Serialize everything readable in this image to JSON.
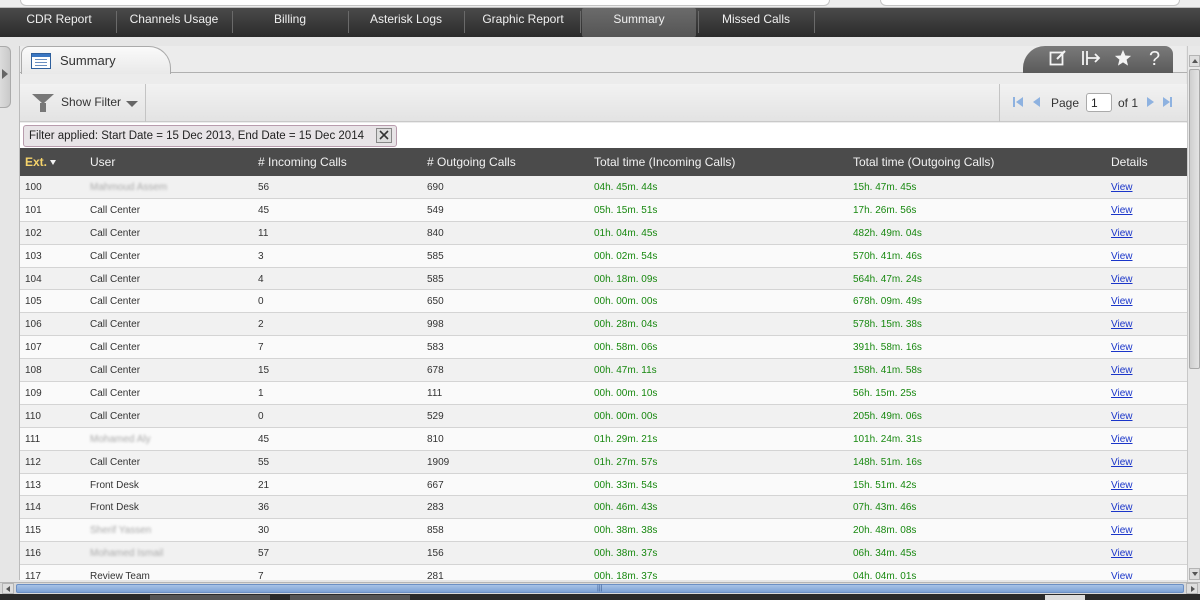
{
  "nav": {
    "items": [
      {
        "label": "CDR Report"
      },
      {
        "label": "Channels Usage"
      },
      {
        "label": "Billing"
      },
      {
        "label": "Asterisk Logs"
      },
      {
        "label": "Graphic Report"
      },
      {
        "label": "Summary"
      },
      {
        "label": "Missed Calls"
      }
    ],
    "active": "Summary"
  },
  "tab": {
    "label": "Summary"
  },
  "toolbar_icons": [
    "edit-icon",
    "export-icon",
    "star-icon",
    "help-icon"
  ],
  "toolbar_glyphs": {
    "help": "?"
  },
  "filter": {
    "show_filter_label": "Show Filter",
    "applied_text": "Filter applied: Start Date = 15 Dec 2013, End Date = 15 Dec 2014"
  },
  "pager": {
    "page_label": "Page",
    "page_value": "1",
    "of_label": "of 1"
  },
  "table": {
    "columns": [
      "Ext.",
      "User",
      "# Incoming Calls",
      "# Outgoing Calls",
      "Total time (Incoming Calls)",
      "Total time (Outgoing Calls)",
      "Details"
    ],
    "sorted_column": "Ext.",
    "rows": [
      {
        "ext": "100",
        "user": "Mahmoud Assem",
        "in": "56",
        "out": "690",
        "tin": "04h. 45m. 44s",
        "tout": "15h. 47m. 45s",
        "details": "View",
        "blur": true
      },
      {
        "ext": "101",
        "user": "Call Center",
        "in": "45",
        "out": "549",
        "tin": "05h. 15m. 51s",
        "tout": "17h. 26m. 56s",
        "details": "View",
        "blur": false
      },
      {
        "ext": "102",
        "user": "Call Center",
        "in": "11",
        "out": "840",
        "tin": "01h. 04m. 45s",
        "tout": "482h. 49m. 04s",
        "details": "View",
        "blur": false
      },
      {
        "ext": "103",
        "user": "Call Center",
        "in": "3",
        "out": "585",
        "tin": "00h. 02m. 54s",
        "tout": "570h. 41m. 46s",
        "details": "View",
        "blur": false
      },
      {
        "ext": "104",
        "user": "Call Center",
        "in": "4",
        "out": "585",
        "tin": "00h. 18m. 09s",
        "tout": "564h. 47m. 24s",
        "details": "View",
        "blur": false
      },
      {
        "ext": "105",
        "user": "Call Center",
        "in": "0",
        "out": "650",
        "tin": "00h. 00m. 00s",
        "tout": "678h. 09m. 49s",
        "details": "View",
        "blur": false
      },
      {
        "ext": "106",
        "user": "Call Center",
        "in": "2",
        "out": "998",
        "tin": "00h. 28m. 04s",
        "tout": "578h. 15m. 38s",
        "details": "View",
        "blur": false
      },
      {
        "ext": "107",
        "user": "Call Center",
        "in": "7",
        "out": "583",
        "tin": "00h. 58m. 06s",
        "tout": "391h. 58m. 16s",
        "details": "View",
        "blur": false
      },
      {
        "ext": "108",
        "user": "Call Center",
        "in": "15",
        "out": "678",
        "tin": "00h. 47m. 11s",
        "tout": "158h. 41m. 58s",
        "details": "View",
        "blur": false
      },
      {
        "ext": "109",
        "user": "Call Center",
        "in": "1",
        "out": "111",
        "tin": "00h. 00m. 10s",
        "tout": "56h. 15m. 25s",
        "details": "View",
        "blur": false
      },
      {
        "ext": "110",
        "user": "Call Center",
        "in": "0",
        "out": "529",
        "tin": "00h. 00m. 00s",
        "tout": "205h. 49m. 06s",
        "details": "View",
        "blur": false
      },
      {
        "ext": "111",
        "user": "Mohamed Aly",
        "in": "45",
        "out": "810",
        "tin": "01h. 29m. 21s",
        "tout": "101h. 24m. 31s",
        "details": "View",
        "blur": true
      },
      {
        "ext": "112",
        "user": "Call Center",
        "in": "55",
        "out": "1909",
        "tin": "01h. 27m. 57s",
        "tout": "148h. 51m. 16s",
        "details": "View",
        "blur": false
      },
      {
        "ext": "113",
        "user": "Front Desk",
        "in": "21",
        "out": "667",
        "tin": "00h. 33m. 54s",
        "tout": "15h. 51m. 42s",
        "details": "View",
        "blur": false
      },
      {
        "ext": "114",
        "user": "Front Desk",
        "in": "36",
        "out": "283",
        "tin": "00h. 46m. 43s",
        "tout": "07h. 43m. 46s",
        "details": "View",
        "blur": false
      },
      {
        "ext": "115",
        "user": "Sherif Yassen",
        "in": "30",
        "out": "858",
        "tin": "00h. 38m. 38s",
        "tout": "20h. 48m. 08s",
        "details": "View",
        "blur": true
      },
      {
        "ext": "116",
        "user": "Mohamed Ismail",
        "in": "57",
        "out": "156",
        "tin": "00h. 38m. 37s",
        "tout": "06h. 34m. 45s",
        "details": "View",
        "blur": true
      },
      {
        "ext": "117",
        "user": "Review Team",
        "in": "7",
        "out": "281",
        "tin": "00h. 18m. 37s",
        "tout": "04h. 04m. 01s",
        "details": "View",
        "blur": false
      }
    ]
  },
  "colors": {
    "header_bg": "#4b4b4b",
    "sorted_header": "#f5d36b",
    "time_green": "#17880f",
    "link_blue": "#1a35c9"
  }
}
